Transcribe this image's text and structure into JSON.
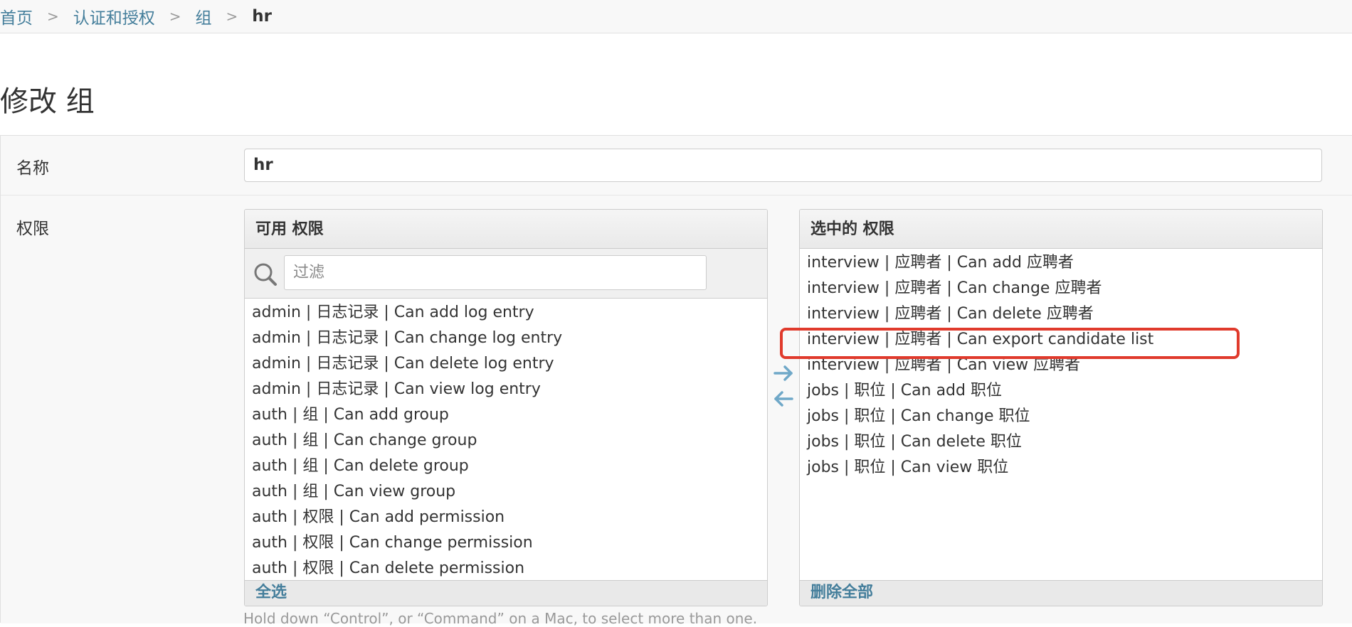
{
  "breadcrumbs": {
    "home": "首页",
    "app": "认证和授权",
    "model": "组",
    "current": "hr"
  },
  "page_title": "修改 组",
  "form": {
    "name_label": "名称",
    "name_value": "hr",
    "permissions_label": "权限"
  },
  "available": {
    "title": "可用 权限",
    "filter_placeholder": "过滤",
    "choose_all": "全选",
    "options": [
      "admin | 日志记录 | Can add log entry",
      "admin | 日志记录 | Can change log entry",
      "admin | 日志记录 | Can delete log entry",
      "admin | 日志记录 | Can view log entry",
      "auth | 组 | Can add group",
      "auth | 组 | Can change group",
      "auth | 组 | Can delete group",
      "auth | 组 | Can view group",
      "auth | 权限 | Can add permission",
      "auth | 权限 | Can change permission",
      "auth | 权限 | Can delete permission"
    ]
  },
  "chosen": {
    "title": "选中的 权限",
    "remove_all": "删除全部",
    "options": [
      "interview | 应聘者 | Can add 应聘者",
      "interview | 应聘者 | Can change 应聘者",
      "interview | 应聘者 | Can delete 应聘者",
      "interview | 应聘者 | Can export candidate list",
      "interview | 应聘者 | Can view 应聘者",
      "jobs | 职位 | Can add 职位",
      "jobs | 职位 | Can change 职位",
      "jobs | 职位 | Can delete 职位",
      "jobs | 职位 | Can view 职位"
    ],
    "highlighted_index": 3
  },
  "help_text": "Hold down “Control”, or “Command” on a Mac, to select more than one.",
  "colors": {
    "link": "#447e9b",
    "highlight": "#e03a2c"
  }
}
